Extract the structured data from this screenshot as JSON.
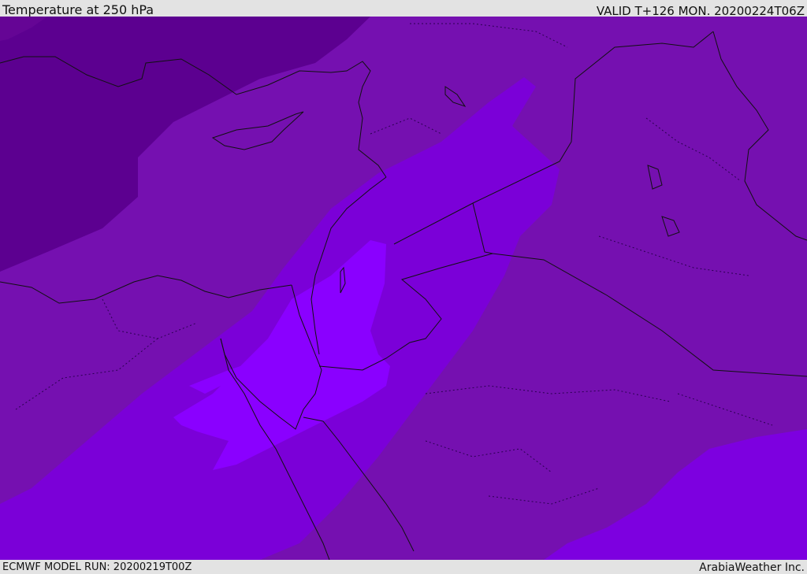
{
  "header": {
    "title": "Temperature at 250 hPa",
    "valid": "VALID T+126 MON. 20200224T06Z"
  },
  "footer": {
    "model_run": "ECMWF MODEL RUN: 20200219T00Z",
    "credit": "ArabiaWeather Inc."
  },
  "map": {
    "variable": "temperature",
    "level": "250 hPa",
    "colors": {
      "darkest": "#5c0090",
      "dark": "#6a0a9c",
      "mid": "#7510b0",
      "light": "#7b00d8",
      "lighter": "#8000ec",
      "brightest": "#8a00ff",
      "border": "#111111"
    },
    "contour_bands": [
      "band-darkest",
      "band-dark",
      "band-mid",
      "band-light",
      "band-lighter",
      "band-brightest"
    ]
  }
}
